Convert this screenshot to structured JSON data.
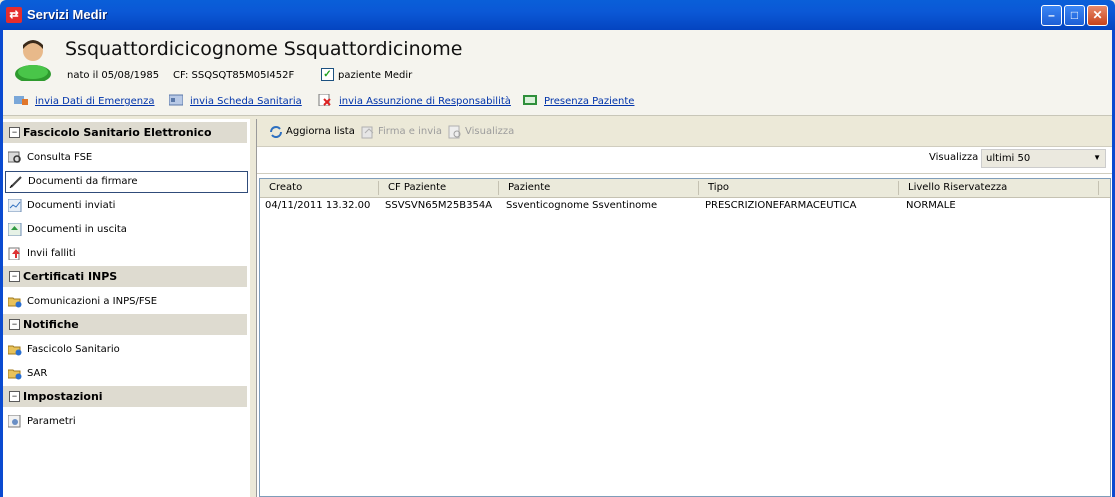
{
  "window": {
    "title": "Servizi Medir",
    "icon": "app-logo-icon"
  },
  "patient": {
    "name": "Ssquattordicicognome Ssquattordicinome",
    "birth": "nato il 05/08/1985",
    "cf": "CF: SSQSQT85M05I452F",
    "medir_label": "paziente Medir",
    "medir_checked": true
  },
  "actions": [
    {
      "label": "invia Dati di Emergenza",
      "icon": "emergency-data-icon"
    },
    {
      "label": "invia Scheda Sanitaria",
      "icon": "health-card-icon"
    },
    {
      "label": "invia Assunzione di Responsabilità",
      "icon": "responsibility-doc-icon"
    },
    {
      "label": "Presenza Paziente",
      "icon": "patient-presence-icon"
    }
  ],
  "sidebar": {
    "sections": [
      {
        "title": "Fascicolo Sanitario Elettronico",
        "items": [
          {
            "label": "Consulta FSE",
            "icon": "browse-fse-icon"
          },
          {
            "label": "Documenti da firmare",
            "icon": "pen-sign-icon"
          },
          {
            "label": "Documenti inviati",
            "icon": "sent-docs-icon"
          },
          {
            "label": "Documenti in uscita",
            "icon": "outbox-docs-icon"
          },
          {
            "label": "Invii falliti",
            "icon": "failed-sends-icon"
          }
        ]
      },
      {
        "title": "Certificati INPS",
        "items": [
          {
            "label": "Comunicazioni a INPS/FSE",
            "icon": "folder-notification-icon"
          }
        ]
      },
      {
        "title": "Notifiche",
        "items": [
          {
            "label": "Fascicolo Sanitario",
            "icon": "folder-notification-icon"
          },
          {
            "label": "SAR",
            "icon": "folder-notification-icon"
          }
        ]
      },
      {
        "title": "Impostazioni",
        "items": [
          {
            "label": "Parametri",
            "icon": "settings-icon"
          }
        ]
      }
    ],
    "selected": "Documenti da firmare"
  },
  "toolbar": {
    "refresh": "Aggiorna lista",
    "sign_send": "Firma e invia",
    "view": "Visualizza"
  },
  "filter": {
    "label": "Visualizza",
    "value": "ultimi 50"
  },
  "grid": {
    "columns": [
      "Creato",
      "CF Paziente",
      "Paziente",
      "Tipo",
      "Livello Riservatezza"
    ],
    "rows": [
      [
        "04/11/2011 13.32.00",
        "SSVSVN65M25B354A",
        "Ssventicognome Ssventinome",
        "PRESCRIZIONEFARMACEUTICA",
        "NORMALE"
      ]
    ]
  },
  "colors": {
    "titlebar": "#0b58d6",
    "link": "#0033aa",
    "section_bg": "#dedbd0"
  }
}
